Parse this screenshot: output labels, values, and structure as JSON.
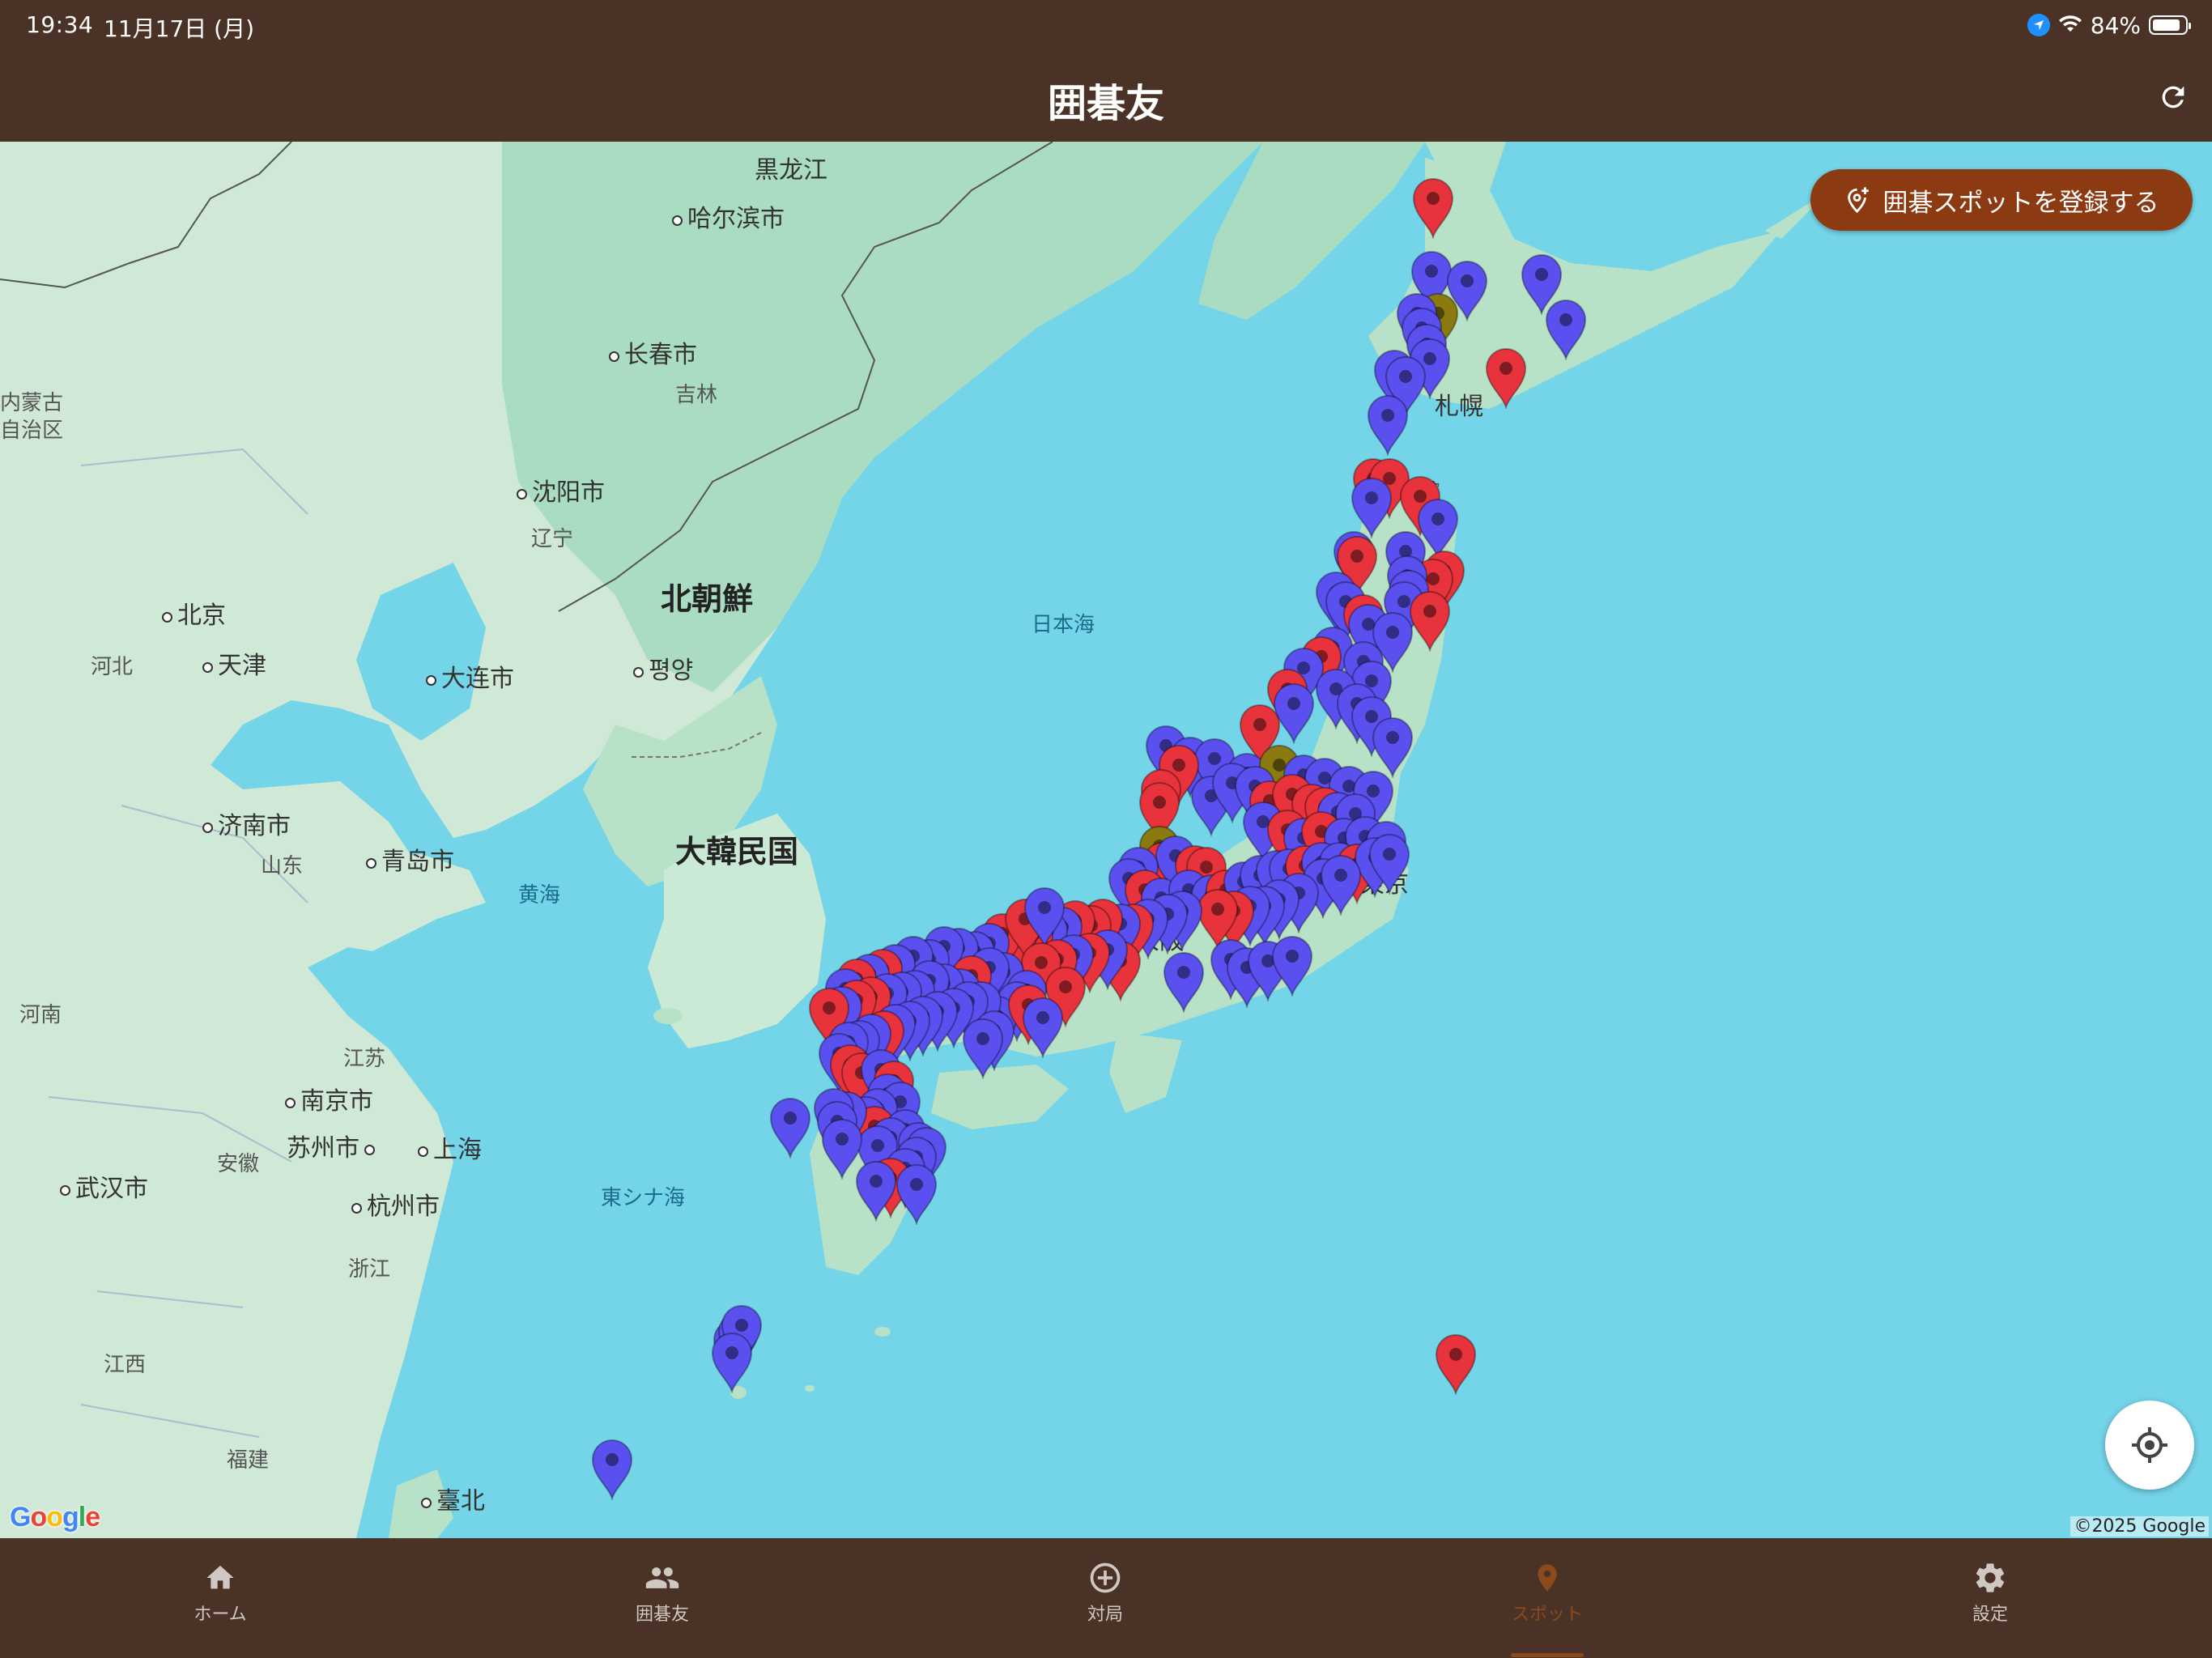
{
  "status_bar": {
    "time": "19:34",
    "date": "11月17日 (月)",
    "battery": "84%"
  },
  "app_bar": {
    "title": "囲碁友",
    "refresh_icon": "refresh-icon"
  },
  "map": {
    "register_button_label": "囲碁スポットを登録する",
    "attribution": "©2025 Google",
    "google_logo": "Google",
    "labels": {
      "heilongjiang": "黒龙江",
      "harbin": "哈尔滨市",
      "changchun": "长春市",
      "jilin": "吉林",
      "neimenggu1": "内蒙古",
      "neimenggu2": "自治区",
      "shenyang": "沈阳市",
      "liaoning": "辽宁",
      "beijing": "北京",
      "tianjin": "天津",
      "hebei": "河北",
      "dalian": "大连市",
      "north_korea": "北朝鮮",
      "pyongyang": "평양",
      "sea_of_japan": "日本海",
      "jinan": "济南市",
      "shandong": "山东",
      "qingdao": "青岛市",
      "yellow_sea": "黄海",
      "south_korea": "大韓民国",
      "henan": "河南",
      "jiangsu": "江苏",
      "nanjing": "南京市",
      "suzhou": "苏州市",
      "shanghai": "上海",
      "anhui": "安徽",
      "wuhan": "武汉市",
      "hangzhou": "杭州市",
      "east_china_sea": "東シナ海",
      "zhejiang": "浙江",
      "jiangxi": "江西",
      "fujian": "福建",
      "taipei": "臺北",
      "sapporo": "札幌",
      "hakodate": "函館",
      "tokyo": "東京",
      "osaka": "大阪"
    }
  },
  "pin_colors": {
    "red": "#e8333c",
    "blue": "#5a50f0",
    "olive": "#8a7a10"
  },
  "bottom_nav": {
    "items": [
      {
        "label": "ホーム",
        "icon": "home-icon"
      },
      {
        "label": "囲碁友",
        "icon": "people-icon"
      },
      {
        "label": "対局",
        "icon": "add-circle-icon"
      },
      {
        "label": "スポット",
        "icon": "location-pin-icon",
        "active": true
      },
      {
        "label": "設定",
        "icon": "gear-icon"
      }
    ]
  }
}
